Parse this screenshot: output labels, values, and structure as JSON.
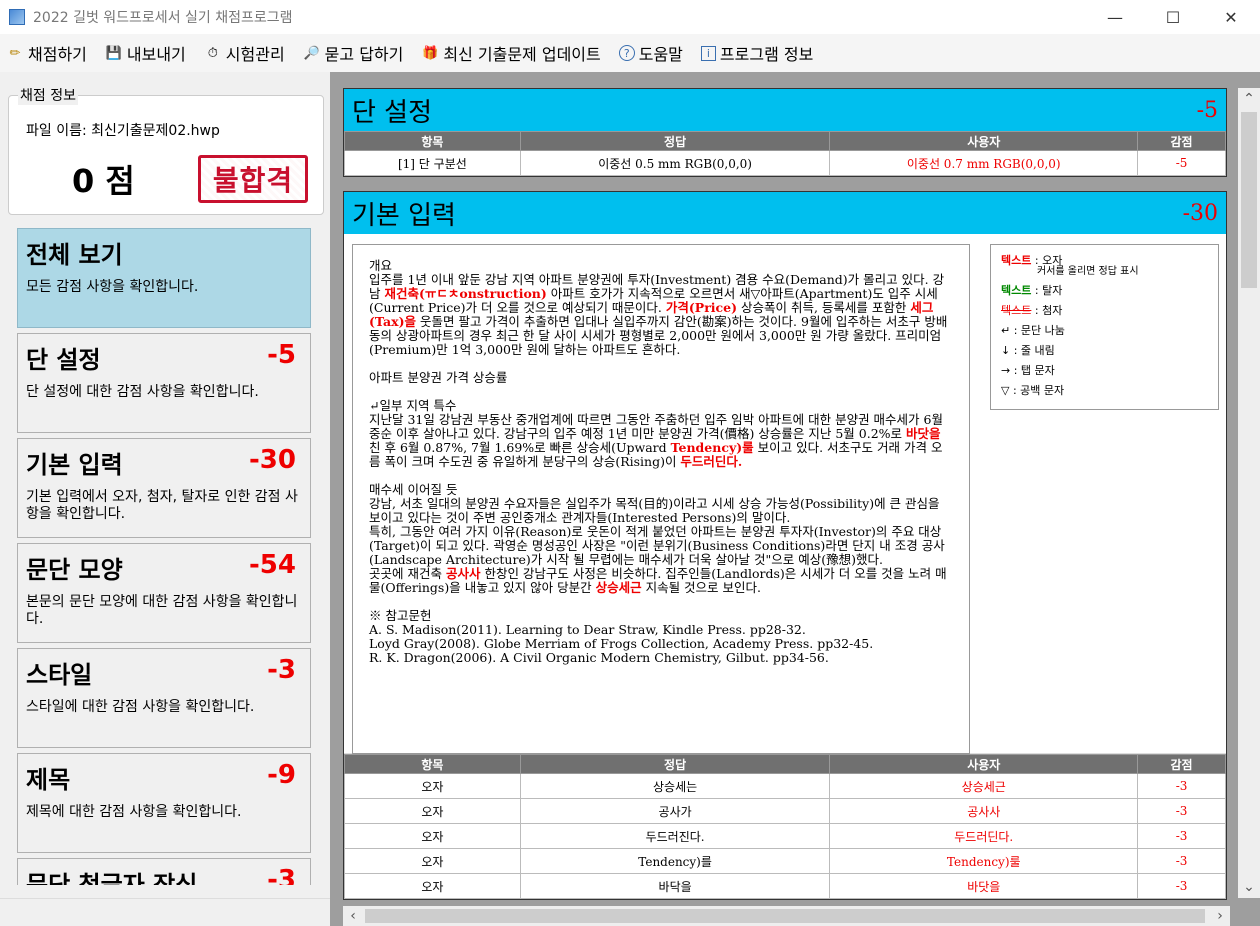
{
  "window": {
    "title": "2022 길벗 워드프로세서 실기 채점프로그램",
    "minimize": "—",
    "maximize": "☐",
    "close": "✕"
  },
  "menu": [
    {
      "label": "채점하기",
      "icon": "✏"
    },
    {
      "label": "내보내기",
      "icon": "💾"
    },
    {
      "label": "시험관리",
      "icon": "⏱"
    },
    {
      "label": "묻고 답하기",
      "icon": "🔎"
    },
    {
      "label": "최신 기출문제 업데이트",
      "icon": "🎁"
    },
    {
      "label": "도움말",
      "icon": "?"
    },
    {
      "label": "프로그램 정보",
      "icon": "i"
    }
  ],
  "info": {
    "legend": "채점 정보",
    "file_name": "파일 이름: 최신기출문제02.hwp",
    "score": "0 점",
    "result": "불합격"
  },
  "categories": [
    {
      "title": "전체 보기",
      "score": "",
      "desc": "모든 감점 사항을 확인합니다."
    },
    {
      "title": "단 설정",
      "score": "-5",
      "desc": "단 설정에 대한 감점 사항을 확인합니다."
    },
    {
      "title": "기본 입력",
      "score": "-30",
      "desc": "기본 입력에서 오자, 첨자, 탈자로 인한 감점 사항을 확인합니다."
    },
    {
      "title": "문단 모양",
      "score": "-54",
      "desc": "본문의 문단 모양에 대한 감점 사항을 확인합니다."
    },
    {
      "title": "스타일",
      "score": "-3",
      "desc": "스타일에 대한 감점 사항을 확인합니다."
    },
    {
      "title": "제목",
      "score": "-9",
      "desc": "제목에 대한 감점 사항을 확인합니다."
    },
    {
      "title": "문단 첫글자 장식",
      "score": "-3",
      "desc": ""
    }
  ],
  "table_headers": {
    "item": "항목",
    "answer": "정답",
    "user": "사용자",
    "deduction": "감점"
  },
  "section1": {
    "title": "단 설정",
    "score": "-5",
    "rows": [
      {
        "item": "[1] 단 구분선",
        "answer": "이중선 0.5 mm RGB(0,0,0)",
        "user": "이중선 0.7 mm RGB(0,0,0)",
        "deduction": "-5"
      }
    ]
  },
  "section2": {
    "title": "기본 입력",
    "score": "-30",
    "doc": {
      "l1": "개요",
      "l2a": "입주를 1년 이내 앞둔 강남 지역 아파트 분양권에 투자(Investment) 겸용 수요(Demand)가 몰리고 있다. 강남 ",
      "l2err": "재건축(ㅠㄷㅊonstruction)",
      "l2b": " 아파트 호가가 지속적으로 오르면서 새▽아파트(Apartment)도 입주 시세(Current Price)가 더 오를 것으로 예상되기 때문이다. ",
      "l2err2": "가격(Price)",
      "l2c": " 상승폭이 취득, 등록세를 포함한 ",
      "l2err3": "세그(Tax)을",
      "l2d": " 웃돌면 팔고 가격이 추출하면 입대나 실입주까지 감안(勘案)하는 것이다. 9월에 입주하는 서초구 방배동의 상광아파트의 경우 최근 한 달 사이 시세가 평형별로 2,000만 원에서 3,000만 원 가량 올랐다. 프리미엄(Premium)만 1억 3,000만 원에 달하는 아파트도 흔하다.",
      "l3": "아파트 분양권 가격 상승률",
      "l4": "↵일부 지역 특수",
      "l5a": "지난달 31일 강남권 부동산 중개업계에 따르면 그동안 주춤하던 입주 임박 아파트에 대한 분양권 매수세가 6월 중순 이후 살아나고 있다. 강남구의 입주 예정 1년 미만 분양권 가격(價格) 상승률은 지난 5월 0.2%로 ",
      "l5err": "바닷을",
      "l5b": " 친 후 6월 0.87%, 7월 1.69%로 빠른 상승세(Upward ",
      "l5err2": "Tendency)룰",
      "l5c": " 보이고 있다. 서초구도 거래 가격 오름 폭이 크며 수도권 중 유일하게 분당구의 상승(Rising)이 ",
      "l5err3": "두드러딘다.",
      "l6": "매수세 이어질 듯",
      "l7": "강남, 서초 일대의 분양권 수요자들은 실입주가 목적(目的)이라고 시세 상승 가능성(Possibility)에 큰 관심을 보이고 있다는 것이 주변 공인중개소 관계자들(Interested Persons)의 말이다.",
      "l8": "특히, 그동안 여러 가지 이유(Reason)로 웃돈이 적게 붙었던 아파트는 분양권 투자자(Investor)의 주요 대상(Target)이 되고 있다. 곽영순 명성공인 사장은 \"이런 분위기(Business Conditions)라면 단지 내 조경 공사(Landscape Architecture)가 시작 될 무렵에는 매수세가 더욱 살아날 것\"으로 예상(豫想)했다.",
      "l9a": "곳곳에 재건축 ",
      "l9err": "공사사",
      "l9b": " 한창인 강남구도 사정은 비슷하다. 집주인들(Landlords)은 시세가 더 오를 것을 노려 매물(Offerings)을 내놓고 있지 않아 당분간 ",
      "l9err2": "상승세근",
      "l9c": " 지속될 것으로 보인다.",
      "ref_title": "※ 참고문헌",
      "ref1": "A. S. Madison(2011). Learning to Dear Straw, Kindle Press. pp28-32.",
      "ref2": "Loyd Gray(2008). Globe Merriam of Frogs Collection, Academy Press. pp32-45.",
      "ref3": "R. K. Dragon(2006). A Civil Organic Modern Chemistry, Gilbut. pp34-56."
    },
    "legend": {
      "red_label": "텍스트",
      "red_desc": ": 오자",
      "red_sub": "커서를 올리면 정답 표시",
      "green_label": "텍스트",
      "green_desc": ": 탈자",
      "strike_label": "텍스트",
      "strike_desc": ": 첨자",
      "para": "↵ : 문단 나눔",
      "line": "↓ : 줄 내림",
      "tab": "→ : 탭 문자",
      "space": "▽ : 공백 문자"
    },
    "rows": [
      {
        "item": "오자",
        "answer": "상승세는",
        "user": "상승세근",
        "deduction": "-3"
      },
      {
        "item": "오자",
        "answer": "공사가",
        "user": "공사사",
        "deduction": "-3"
      },
      {
        "item": "오자",
        "answer": "두드러진다.",
        "user": "두드러딘다.",
        "deduction": "-3"
      },
      {
        "item": "오자",
        "answer": "Tendency)를",
        "user": "Tendency)룰",
        "deduction": "-3"
      },
      {
        "item": "오자",
        "answer": "바닥을",
        "user": "바닷을",
        "deduction": "-3"
      }
    ]
  }
}
